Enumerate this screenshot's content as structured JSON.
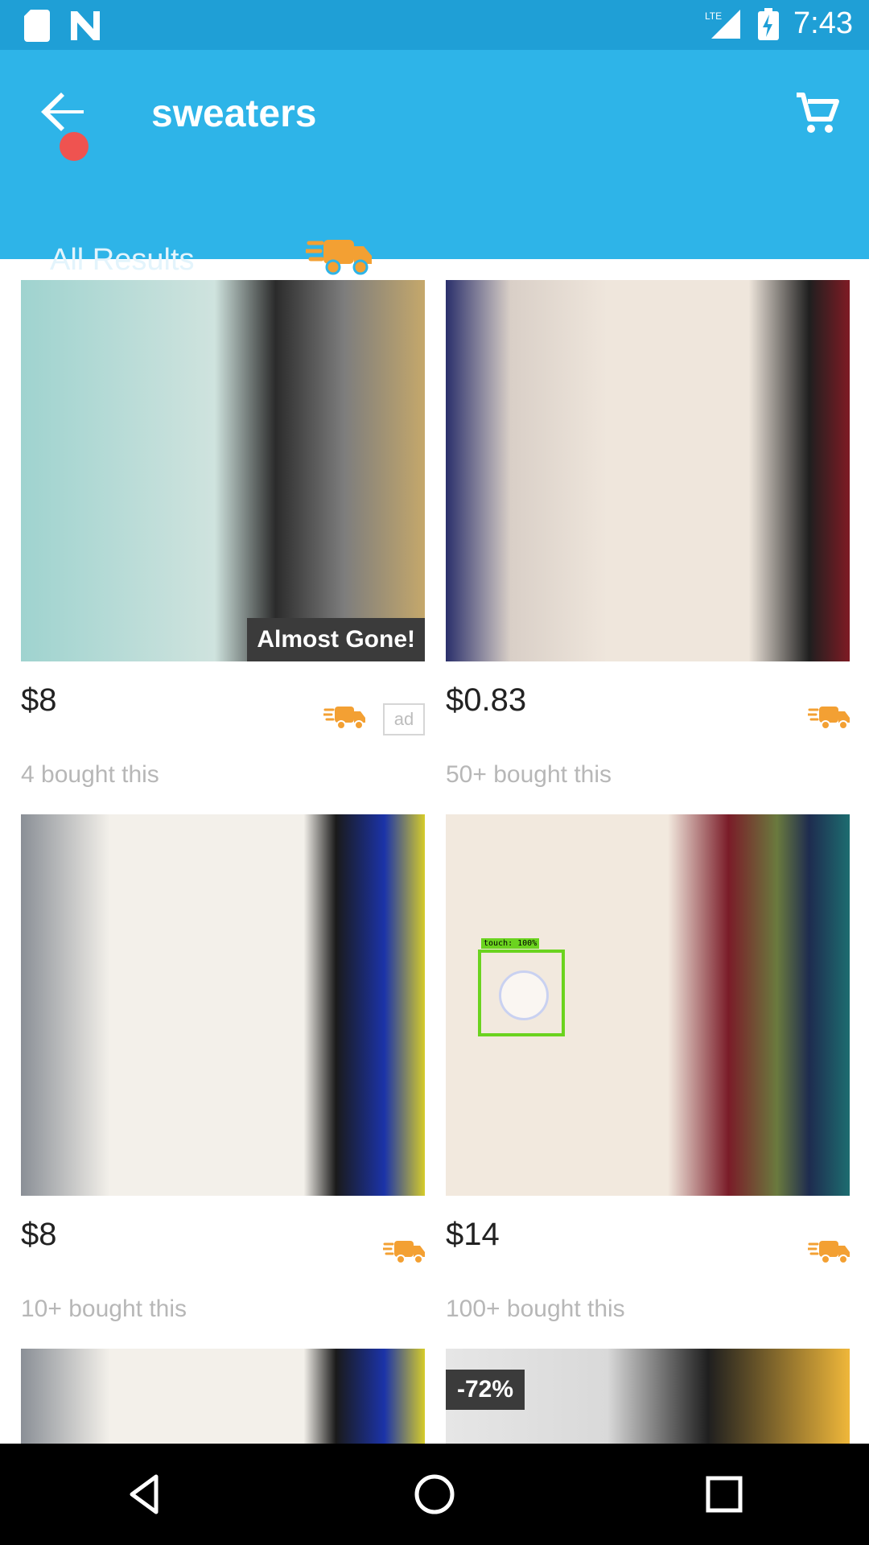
{
  "status": {
    "time": "7:43",
    "network": "LTE"
  },
  "app_bar": {
    "title": "sweaters"
  },
  "tabs": [
    {
      "label": "All Results"
    }
  ],
  "products": [
    {
      "price": "$8",
      "bought": "4 bought this",
      "badge": "Almost Gone!",
      "ad_label": "ad"
    },
    {
      "price": "$0.83",
      "bought": "50+ bought this"
    },
    {
      "price": "$8",
      "bought": "10+ bought this"
    },
    {
      "price": "$14",
      "bought": "100+ bought this",
      "overlay_label": "touch: 100%"
    },
    {
      "price": "",
      "bought": ""
    },
    {
      "price": "",
      "bought": "",
      "badge": "-72%"
    }
  ],
  "colors": {
    "appbar": "#2eb4e8",
    "status": "#1f9fd6",
    "truck": "#f3a033"
  },
  "icons": [
    "sd-card-icon",
    "n-logo-icon",
    "lte-signal-icon",
    "battery-charging-icon",
    "back-arrow-icon",
    "cart-icon",
    "fast-delivery-truck-icon",
    "nav-back-icon",
    "nav-home-icon",
    "nav-recent-icon"
  ]
}
